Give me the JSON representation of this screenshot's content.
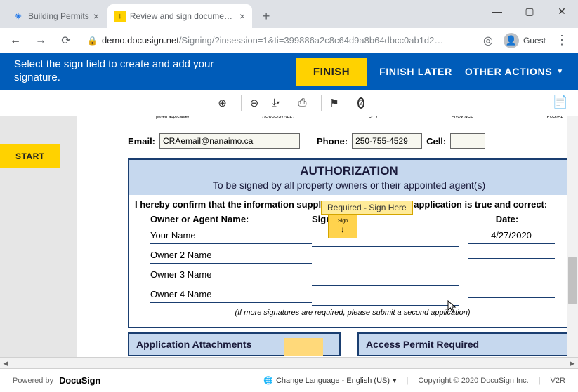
{
  "window": {
    "minimize": "—",
    "maximize": "▢",
    "close": "✕"
  },
  "tabs": {
    "inactive": {
      "title": "Building Permits"
    },
    "active": {
      "title": "Review and sign document(s) | D"
    },
    "new": "+"
  },
  "toolbar": {
    "back": "←",
    "forward": "→",
    "reload": "⟳",
    "url_host": "demo.docusign.net",
    "url_path": "/Signing/?insession=1&ti=399886a2c8c64d9a8b64dbcc0ab1d2…",
    "target": "◎",
    "guest": "Guest",
    "menu": "⋮"
  },
  "banner": {
    "prompt1": "Select the sign field to create and add your",
    "prompt2": "signature.",
    "finish": "FINISH",
    "finish_later": "FINISH LATER",
    "other_actions": "OTHER ACTIONS"
  },
  "tools": {
    "zoom_in": "⊕",
    "zoom_out": "⊖",
    "download": "⤓",
    "print": "⎙",
    "comment": "⚑",
    "help": "?"
  },
  "start": "START",
  "doc": {
    "meta_applicable": "(when applicable)",
    "meta_house": "HOUSE/STREET",
    "meta_city": "CITY",
    "meta_province": "PROVINCE",
    "meta_postal": "POSTAL",
    "email_label": "Email:",
    "email_value": "CRAemail@nanaimo.ca",
    "phone_label": "Phone:",
    "phone_value": "250-755-4529",
    "cell_label": "Cell:",
    "auth_title": "AUTHORIZATION",
    "auth_sub": "To be signed by all property owners or their appointed agent(s)",
    "confirm": "I hereby confirm that the information supplied in support of this application is true and correct:",
    "col_name": "Owner or Agent Name:",
    "col_sig": "Signature:",
    "col_date": "Date:",
    "rows": [
      {
        "name": "Your Name",
        "date": "4/27/2020"
      },
      {
        "name": "Owner 2 Name",
        "date": ""
      },
      {
        "name": "Owner 3 Name",
        "date": ""
      },
      {
        "name": "Owner 4 Name",
        "date": ""
      }
    ],
    "more_sig": "(If more signatures are required, please submit a second application)",
    "attach_label": "Application Attachments",
    "access_label": "Access Permit Required"
  },
  "sign_tag": {
    "tooltip": "Required - Sign Here",
    "label": "Sign",
    "arrow": "↓"
  },
  "footer": {
    "powered": "Powered by",
    "logo": "DocuSign",
    "globe": "🌐",
    "lang": "Change Language - English (US)",
    "caret": "▾",
    "copyright": "Copyright © 2020 DocuSign Inc.",
    "version": "V2R"
  }
}
